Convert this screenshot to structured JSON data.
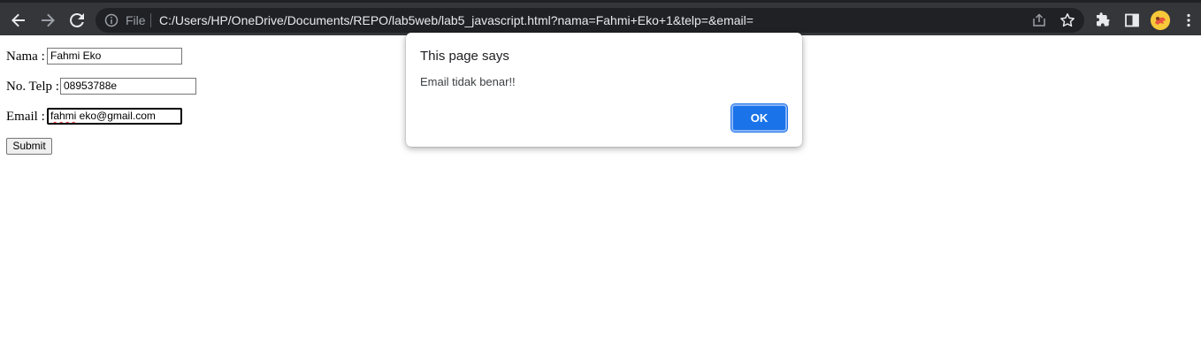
{
  "browser": {
    "scheme_label": "File",
    "url": "C:/Users/HP/OneDrive/Documents/REPO/lab5web/lab5_javascript.html?nama=Fahmi+Eko+1&telp=&email=",
    "icons": [
      "back-icon",
      "forward-icon",
      "reload-icon",
      "info-icon",
      "share-icon",
      "star-icon",
      "extensions-icon",
      "side-panel-icon",
      "profile-avatar",
      "menu-icon"
    ]
  },
  "form": {
    "nama_label": "Nama :",
    "nama_value": "Fahmi Eko",
    "telp_label": "No. Telp :",
    "telp_value": "08953788e",
    "email_label": "Email :",
    "email_value_misspelled": "fahmi",
    "email_value_rest": " eko@gmail.com",
    "submit_label": "Submit"
  },
  "dialog": {
    "title": "This page says",
    "message": "Email tidak benar!!",
    "ok_label": "OK"
  },
  "colors": {
    "toolbar_bg": "#35363a",
    "omnibox_bg": "#202124",
    "accent": "#1a73e8"
  }
}
